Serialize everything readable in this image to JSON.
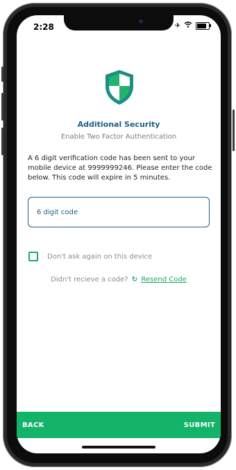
{
  "status_bar": {
    "time": "2:28",
    "icons": [
      "airplane-icon",
      "wifi-icon",
      "battery-icon"
    ]
  },
  "header": {
    "title": "Additional Security",
    "subtitle": "Enable Two Factor Authentication"
  },
  "message": "A 6 digit verification code has been sent to your mobile device at 9999999246. Please enter the code below. This code will expire in 5 minutes.",
  "code_field": {
    "placeholder": "6 digit code"
  },
  "remember_device": {
    "label": "Don't ask again on this device",
    "checked": false
  },
  "resend": {
    "prompt": "Didn't recieve a code?",
    "link_label": "Resend Code"
  },
  "footer": {
    "back_label": "BACK",
    "submit_label": "SUBMIT"
  },
  "colors": {
    "accent": "#14b36a",
    "primary_text": "#1c5d86",
    "shield_dark": "#1c8f84",
    "shield_light": "#24b36e"
  }
}
